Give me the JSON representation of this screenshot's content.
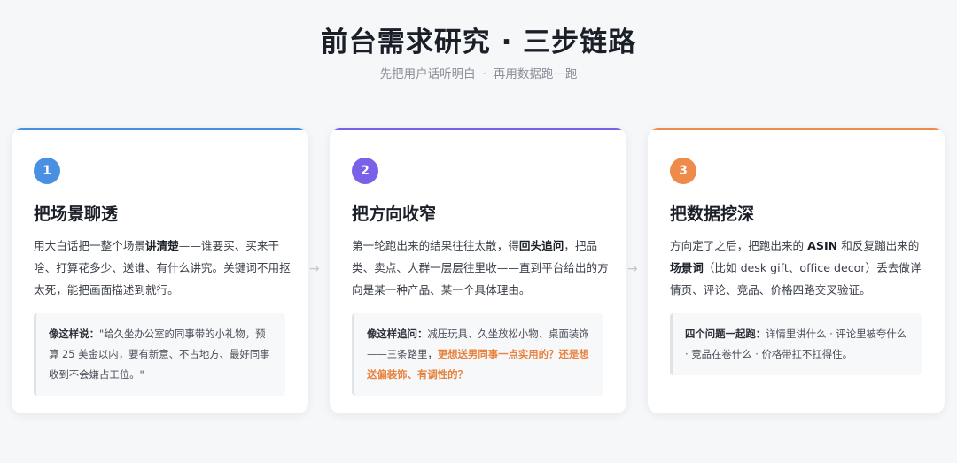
{
  "header": {
    "title": "前台需求研究 · 三步链路",
    "subtitle_left": "先把用户话听明白",
    "subtitle_sep": "·",
    "subtitle_right": "再用数据跑一跑"
  },
  "colors": {
    "step1": "#4a90e2",
    "step2": "#7b61e8",
    "step3": "#ee8a4a",
    "highlight": "#e8823e"
  },
  "arrow_glyph": "→",
  "cards": [
    {
      "number": "1",
      "title": "把场景聊透",
      "desc_a": "用大白话把一整个场景",
      "desc_bold": "讲清楚",
      "desc_b": "——谁要买、买来干啥、打算花多少、送谁、有什么讲究。关键词不用抠太死，能把画面描述到就行。",
      "quote_lead": "像这样说：",
      "quote_text": "\"给久坐办公室的同事带的小礼物，预算 25 美金以内，要有新意、不占地方、最好同事收到不会嫌占工位。\""
    },
    {
      "number": "2",
      "title": "把方向收窄",
      "desc_a": "第一轮跑出来的结果往往太散，得",
      "desc_bold": "回头追问",
      "desc_b": "，把品类、卖点、人群一层层往里收——直到平台给出的方向是某一种产品、某一个具体理由。",
      "quote_lead": "像这样追问：",
      "quote_text": "减压玩具、久坐放松小物、桌面装饰——三条路里，",
      "quote_highlight": "更想送男同事一点实用的？还是想送偏装饰、有调性的？"
    },
    {
      "number": "3",
      "title": "把数据挖深",
      "desc_a": "方向定了之后，把跑出来的 ",
      "desc_bold": "ASIN",
      "desc_b": " 和反复蹦出来的",
      "desc_bold2": "场景词",
      "desc_c": "（比如 desk gift、office decor）丢去做详情页、评论、竞品、价格四路交叉验证。",
      "quote_lead": "四个问题一起跑：",
      "quote_text": "详情里讲什么 · 评论里被夸什么 · 竞品在卷什么 · 价格带扛不扛得住。"
    }
  ]
}
